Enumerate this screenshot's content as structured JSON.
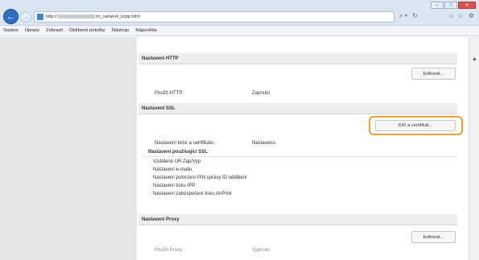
{
  "window": {
    "minimize": "–",
    "maximize": "□",
    "close": "✕"
  },
  "browser": {
    "back": "←",
    "forward": "→",
    "url_prefix": "http://",
    "url_suffix": "/m_network_tcpip.html",
    "addr_tools": [
      "⌕ ▾",
      "↻"
    ],
    "icons": [
      "⌂",
      "☆",
      "⚙"
    ]
  },
  "menubar": {
    "items": [
      "Soubor",
      "Úpravy",
      "Zobrazit",
      "Oblíbené položky",
      "Nástroje",
      "Nápověda"
    ]
  },
  "http": {
    "header": "Nastavení HTTP",
    "edit": "Editovat...",
    "use_label": "Použít HTTP:",
    "use_value": "Zapnuto"
  },
  "ssl": {
    "header": "Nastavení SSL",
    "key_button": "Klíč a certifikát...",
    "key_label": "Nastavení klíče a certifikátu:",
    "key_value": "Nastaveno.",
    "using_header": "Nastavení používající SSL",
    "items": [
      "Vzdálené UR Zap/Vyp",
      "Nastavení e-mailu",
      "Nastavení potvrzení PIN správy ID oddělení",
      "Nastavení tisku IPP",
      "Nastavení zabezpečení tisku AirPrint"
    ]
  },
  "proxy": {
    "header": "Nastavení Proxy",
    "edit": "Editovat...",
    "use_label": "Použít Proxy:",
    "use_value": "Vypnuto"
  }
}
